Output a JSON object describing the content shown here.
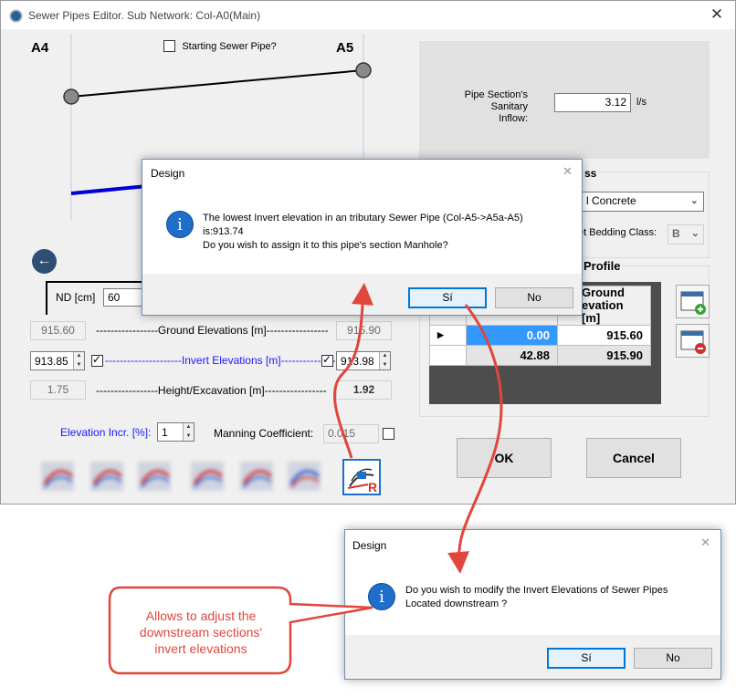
{
  "window": {
    "title": "Sewer Pipes Editor. Sub Network: Col-A0(Main)",
    "close": "✕"
  },
  "editor": {
    "node_left": "A4",
    "node_right": "A5",
    "starting_pipe_label": "Starting Sewer Pipe?",
    "back_arrow": "←",
    "nd_label": "ND [cm]",
    "nd_value": "60",
    "ground_left": "915.60",
    "ground_label": "-----------------Ground Elevations [m]-----------------",
    "ground_right": "915.90",
    "invert_left": "913.85",
    "invert_label": "---------------------Invert Elevations [m]---------------------",
    "invert_right": "913.98",
    "height_left": "1.75",
    "height_label": "-----------------Height/Excavation [m]-----------------",
    "height_right": "1.92",
    "elevation_incr_label": "Elevation Incr. [%]:",
    "elevation_incr_value": "1",
    "manning_label": "Manning Coefficient:",
    "manning_value": "0.015"
  },
  "right_panel": {
    "inflow_label_line1": "Pipe Section's",
    "inflow_label_line2": "Sanitary Inflow:",
    "inflow_value": "3.12",
    "inflow_unit": "l/s",
    "material_heading_fragment": "ss",
    "material_value": "l Concrete",
    "bedding_label": "et Bedding Class:",
    "bedding_value": "B",
    "profile_heading": "Profile",
    "table_header_line1": "Ground",
    "table_header_line2": "evation [m]",
    "rows": [
      {
        "x": "0.00",
        "elev": "915.60"
      },
      {
        "x": "42.88",
        "elev": "915.90"
      }
    ]
  },
  "buttons": {
    "ok": "OK",
    "cancel": "Cancel"
  },
  "dialog1": {
    "title": "Design",
    "line1": "The lowest Invert elevation in an tributary Sewer Pipe (Col-A5->A5a-A5)",
    "line2": "is:913.74",
    "line3": "Do you wish to assign it to this pipe's section Manhole?",
    "yes": "Sí",
    "no": "No",
    "icon": "i"
  },
  "dialog2": {
    "title": "Design",
    "line1": "Do you wish to modify the Invert Elevations of Sewer Pipes",
    "line2": "Located downstream ?",
    "yes": "Sí",
    "no": "No",
    "icon": "i"
  },
  "callout": {
    "line1": "Allows to adjust the",
    "line2": "downstream sections'",
    "line3": "invert elevations"
  },
  "colors": {
    "accent": "#1f6ec9",
    "arrow": "#e0463c",
    "callout_text": "#e0463c"
  }
}
